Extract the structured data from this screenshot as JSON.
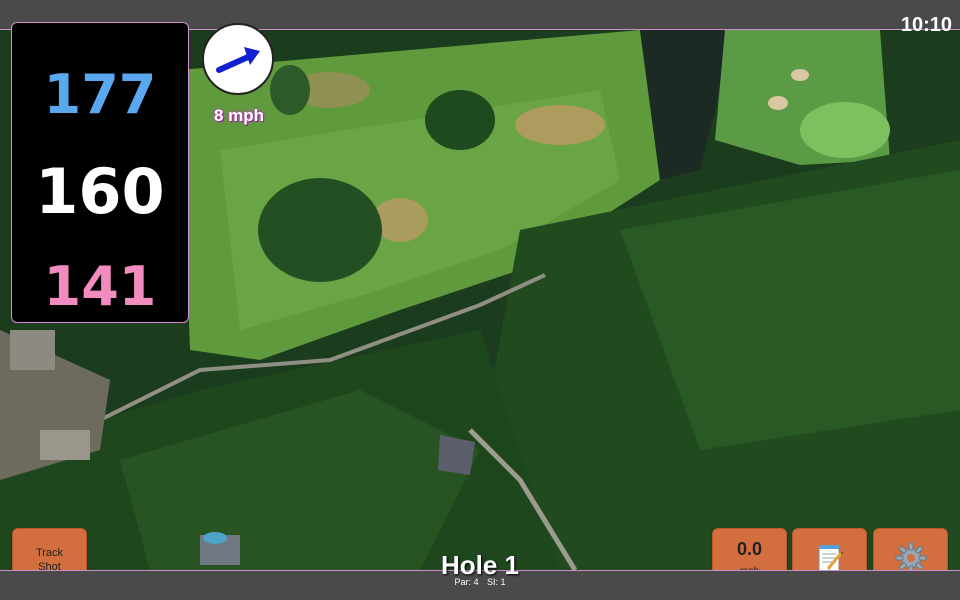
{
  "status_bar": {
    "time": "10:10"
  },
  "distances": {
    "back": "177",
    "middle": "160",
    "front": "141"
  },
  "wind": {
    "speed": "8 mph",
    "direction_icon": "wind-arrow-icon"
  },
  "buttons": {
    "track_shot_line1": "Track",
    "track_shot_line2": "Shot",
    "speed_value": "0.0",
    "speed_unit": "mph",
    "notes_icon": "notepad-icon",
    "settings_icon": "gear-icon"
  },
  "hole": {
    "title": "Hole 1",
    "par": "Par: 4",
    "si": "SI: 1"
  },
  "colors": {
    "back_distance": "#5aa8f0",
    "middle_distance": "#ffffff",
    "front_distance": "#f28cc0",
    "button": "#d36f3e",
    "accent_border": "#d58cd5"
  }
}
